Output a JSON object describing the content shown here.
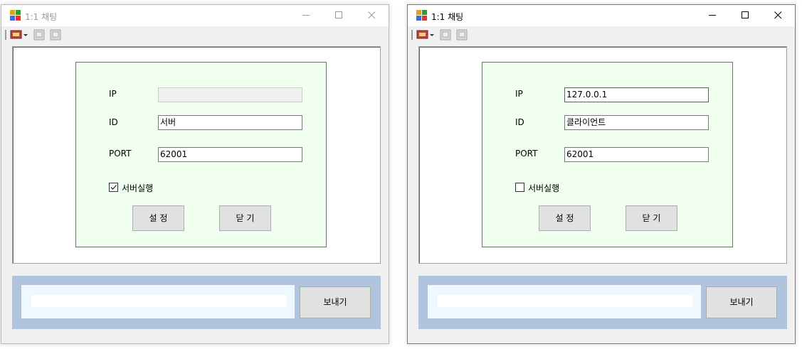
{
  "windows": [
    {
      "title": "1:1 채팅",
      "state": "inactive",
      "toolbar_icons": [
        "settings-dropdown-icon",
        "connect-icon",
        "disconnect-icon"
      ],
      "form": {
        "ip_label": "IP",
        "ip_value": "",
        "ip_enabled": false,
        "id_label": "ID",
        "id_value": "서버",
        "port_label": "PORT",
        "port_value": "62001",
        "server_checkbox_label": "서버실행",
        "server_checked": true,
        "set_button": "설 정",
        "close_button": "닫 기"
      },
      "chat": {
        "message_value": "",
        "send_button": "보내기"
      }
    },
    {
      "title": "1:1 채팅",
      "state": "active",
      "toolbar_icons": [
        "settings-dropdown-icon",
        "connect-icon",
        "disconnect-icon"
      ],
      "form": {
        "ip_label": "IP",
        "ip_value": "127.0.0.1",
        "ip_enabled": true,
        "id_label": "ID",
        "id_value": "클라이언트",
        "port_label": "PORT",
        "port_value": "62001",
        "server_checkbox_label": "서버실행",
        "server_checked": false,
        "set_button": "설 정",
        "close_button": "닫 기"
      },
      "chat": {
        "message_value": "",
        "send_button": "보내기"
      }
    }
  ],
  "colors": {
    "form_panel_bg": "#f0fff0",
    "chat_area_bg": "#b0c4de",
    "message_box_bg": "#f0f8ff",
    "focus_border": "#0078d7"
  }
}
